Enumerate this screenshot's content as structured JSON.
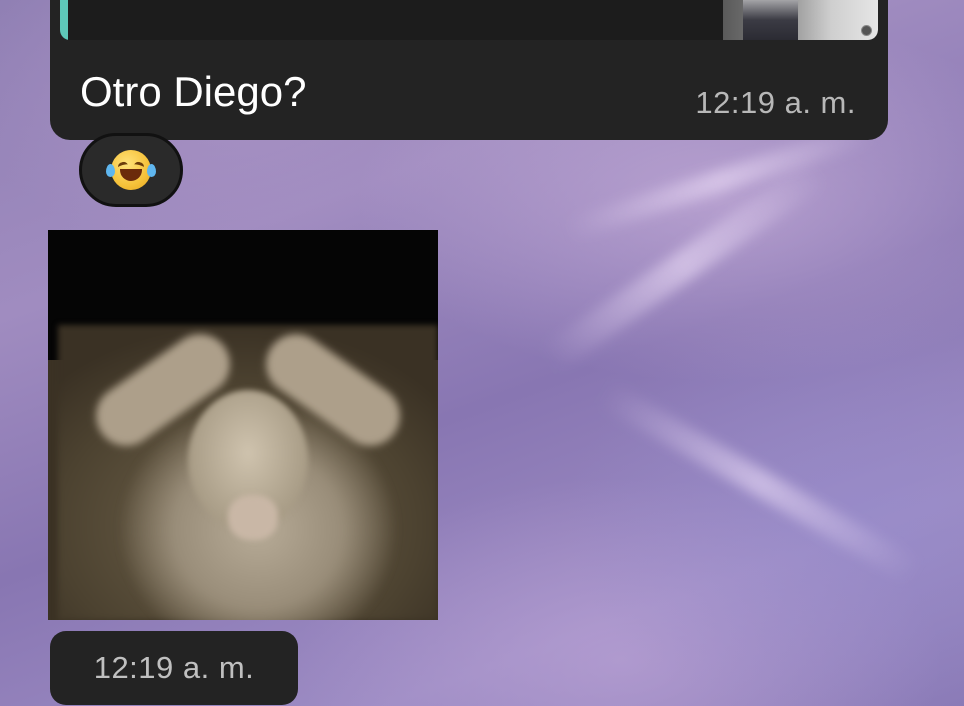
{
  "background": {
    "accent_color": "#9a88c0"
  },
  "message": {
    "text": "Otro Diego?",
    "time": "12:19 a. m.",
    "bubble_color": "#232323",
    "quote_accent_color": "#5ec8b8"
  },
  "reaction": {
    "emoji": "face-with-tears-of-joy"
  },
  "media": {
    "type": "gif",
    "description_icon": "laughing-monkey-gif",
    "time": "12:19 a. m."
  }
}
